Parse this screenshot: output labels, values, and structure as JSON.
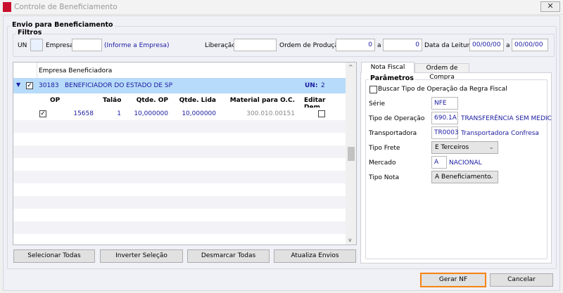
{
  "window": {
    "title": "Controle de Beneficiamento",
    "close": "✕",
    "logo_text": "T"
  },
  "group_title": "Envio para Beneficiamento",
  "filters": {
    "title": "Filtros",
    "un_label": "UN",
    "un_value": "",
    "empresa_label": "Empresa",
    "empresa_value": "",
    "empresa_hint": "(Informe a Empresa)",
    "liberacao_label": "Liberação",
    "liberacao_value": "",
    "op_label": "Ordem de Produção",
    "op_from": "0",
    "a1": "a",
    "op_to": "0",
    "data_label": "Data da Leitura",
    "data_from": "00/00/00",
    "a2": "a",
    "data_to": "00/00/00"
  },
  "grid": {
    "header": "Empresa Beneficiadora",
    "group": {
      "code": "30183",
      "name": "BENEFICIADOR DO ESTADO DE SP",
      "un_label": "UN:",
      "un_value": "2",
      "checked": true
    },
    "columns": [
      "OP",
      "Talão",
      "Qtde. OP",
      "Qtde. Lida",
      "Material para O.C.",
      "Editar Dem."
    ],
    "rows": [
      {
        "checked": true,
        "op": "15658",
        "talao": "1",
        "qtde_op": "10,000000",
        "qtde_lida": "10,000000",
        "material": "300.010.00151",
        "editar": false
      }
    ]
  },
  "buttons": {
    "select_all": "Selecionar Todas",
    "invert": "Inverter Seleção",
    "unselect_all": "Desmarcar Todas",
    "refresh": "Atualiza Envios",
    "generate": "Gerar NF",
    "cancel": "Cancelar"
  },
  "tabs": [
    {
      "label": "Nota Fiscal",
      "active": true
    },
    {
      "label": "Ordem de Compra",
      "active": false
    }
  ],
  "params": {
    "title": "Parâmetros",
    "buscar_label": "Buscar Tipo de Operação da Regra Fiscal",
    "buscar_checked": false,
    "serie_label": "Série",
    "serie_value": "NFE",
    "tipo_op_label": "Tipo de Operação",
    "tipo_op_value": "690.1A",
    "tipo_op_desc": "TRANSFERÊNCIA SEM MEDIC",
    "transp_label": "Transportadora",
    "transp_value": "TR0003",
    "transp_desc": "Transportadora Confresa",
    "frete_label": "Tipo Frete",
    "frete_value": "E Terceiros",
    "mercado_label": "Mercado",
    "mercado_value": "A",
    "mercado_desc": "NACIONAL",
    "nota_label": "Tipo Nota",
    "nota_value": "A Beneficiamento"
  },
  "colors": {
    "accent_focus": "#f7830f",
    "selected_row": "#b7dbfa",
    "link": "#1a1aa0"
  }
}
